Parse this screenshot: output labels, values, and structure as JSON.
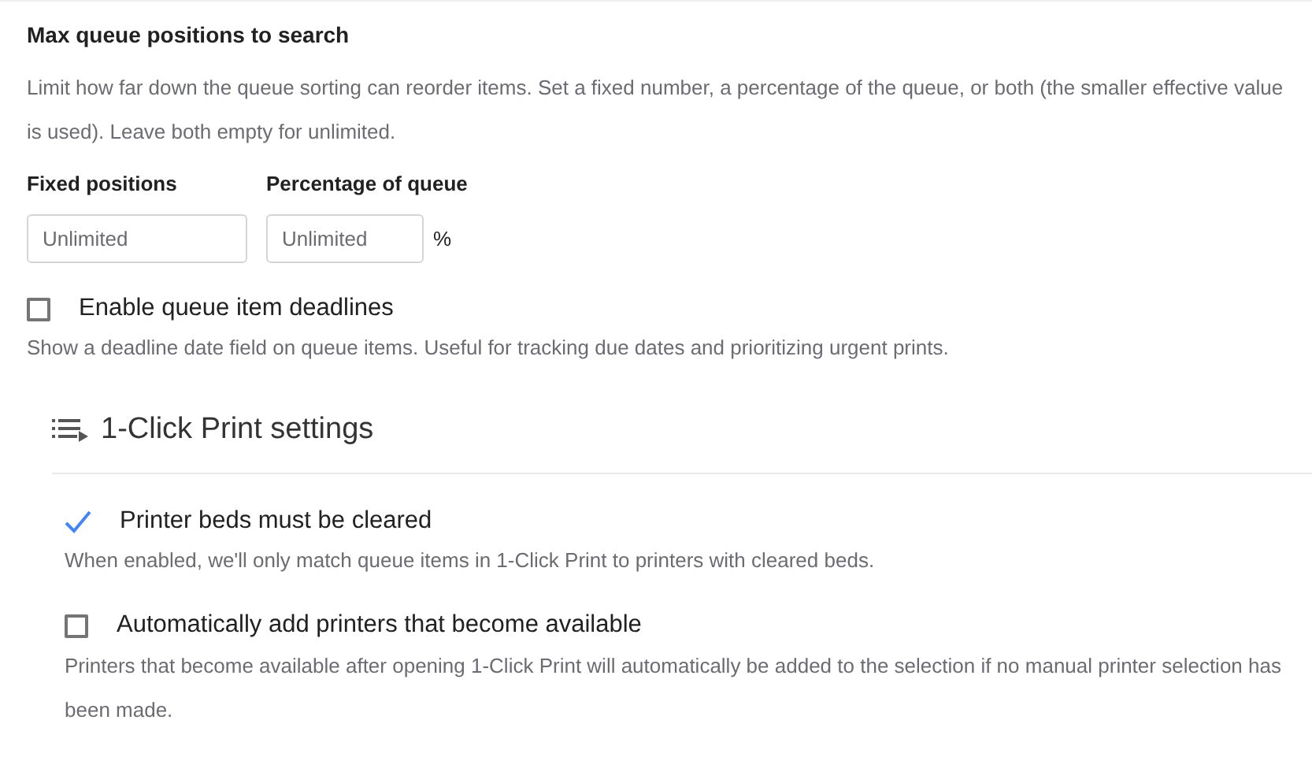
{
  "queue_limit": {
    "title": "Max queue positions to search",
    "description": "Limit how far down the queue sorting can reorder items. Set a fixed number, a percentage of the queue, or both (the smaller effective value is used). Leave both empty for unlimited.",
    "fields": [
      {
        "label": "Fixed positions",
        "placeholder": "Unlimited"
      },
      {
        "label": "Percentage of queue",
        "placeholder": "Unlimited",
        "suffix": "%"
      }
    ]
  },
  "deadlines": {
    "label": "Enable queue item deadlines",
    "checked": false,
    "description": "Show a deadline date field on queue items. Useful for tracking due dates and prioritizing urgent prints."
  },
  "one_click": {
    "title": "1-Click Print settings",
    "options": [
      {
        "label": "Printer beds must be cleared",
        "checked": true,
        "description": "When enabled, we'll only match queue items in 1-Click Print to printers with cleared beds."
      },
      {
        "label": "Automatically add printers that become available",
        "checked": false,
        "description": "Printers that become available after opening 1-Click Print will automatically be added to the selection if no manual printer selection has been made."
      }
    ]
  }
}
